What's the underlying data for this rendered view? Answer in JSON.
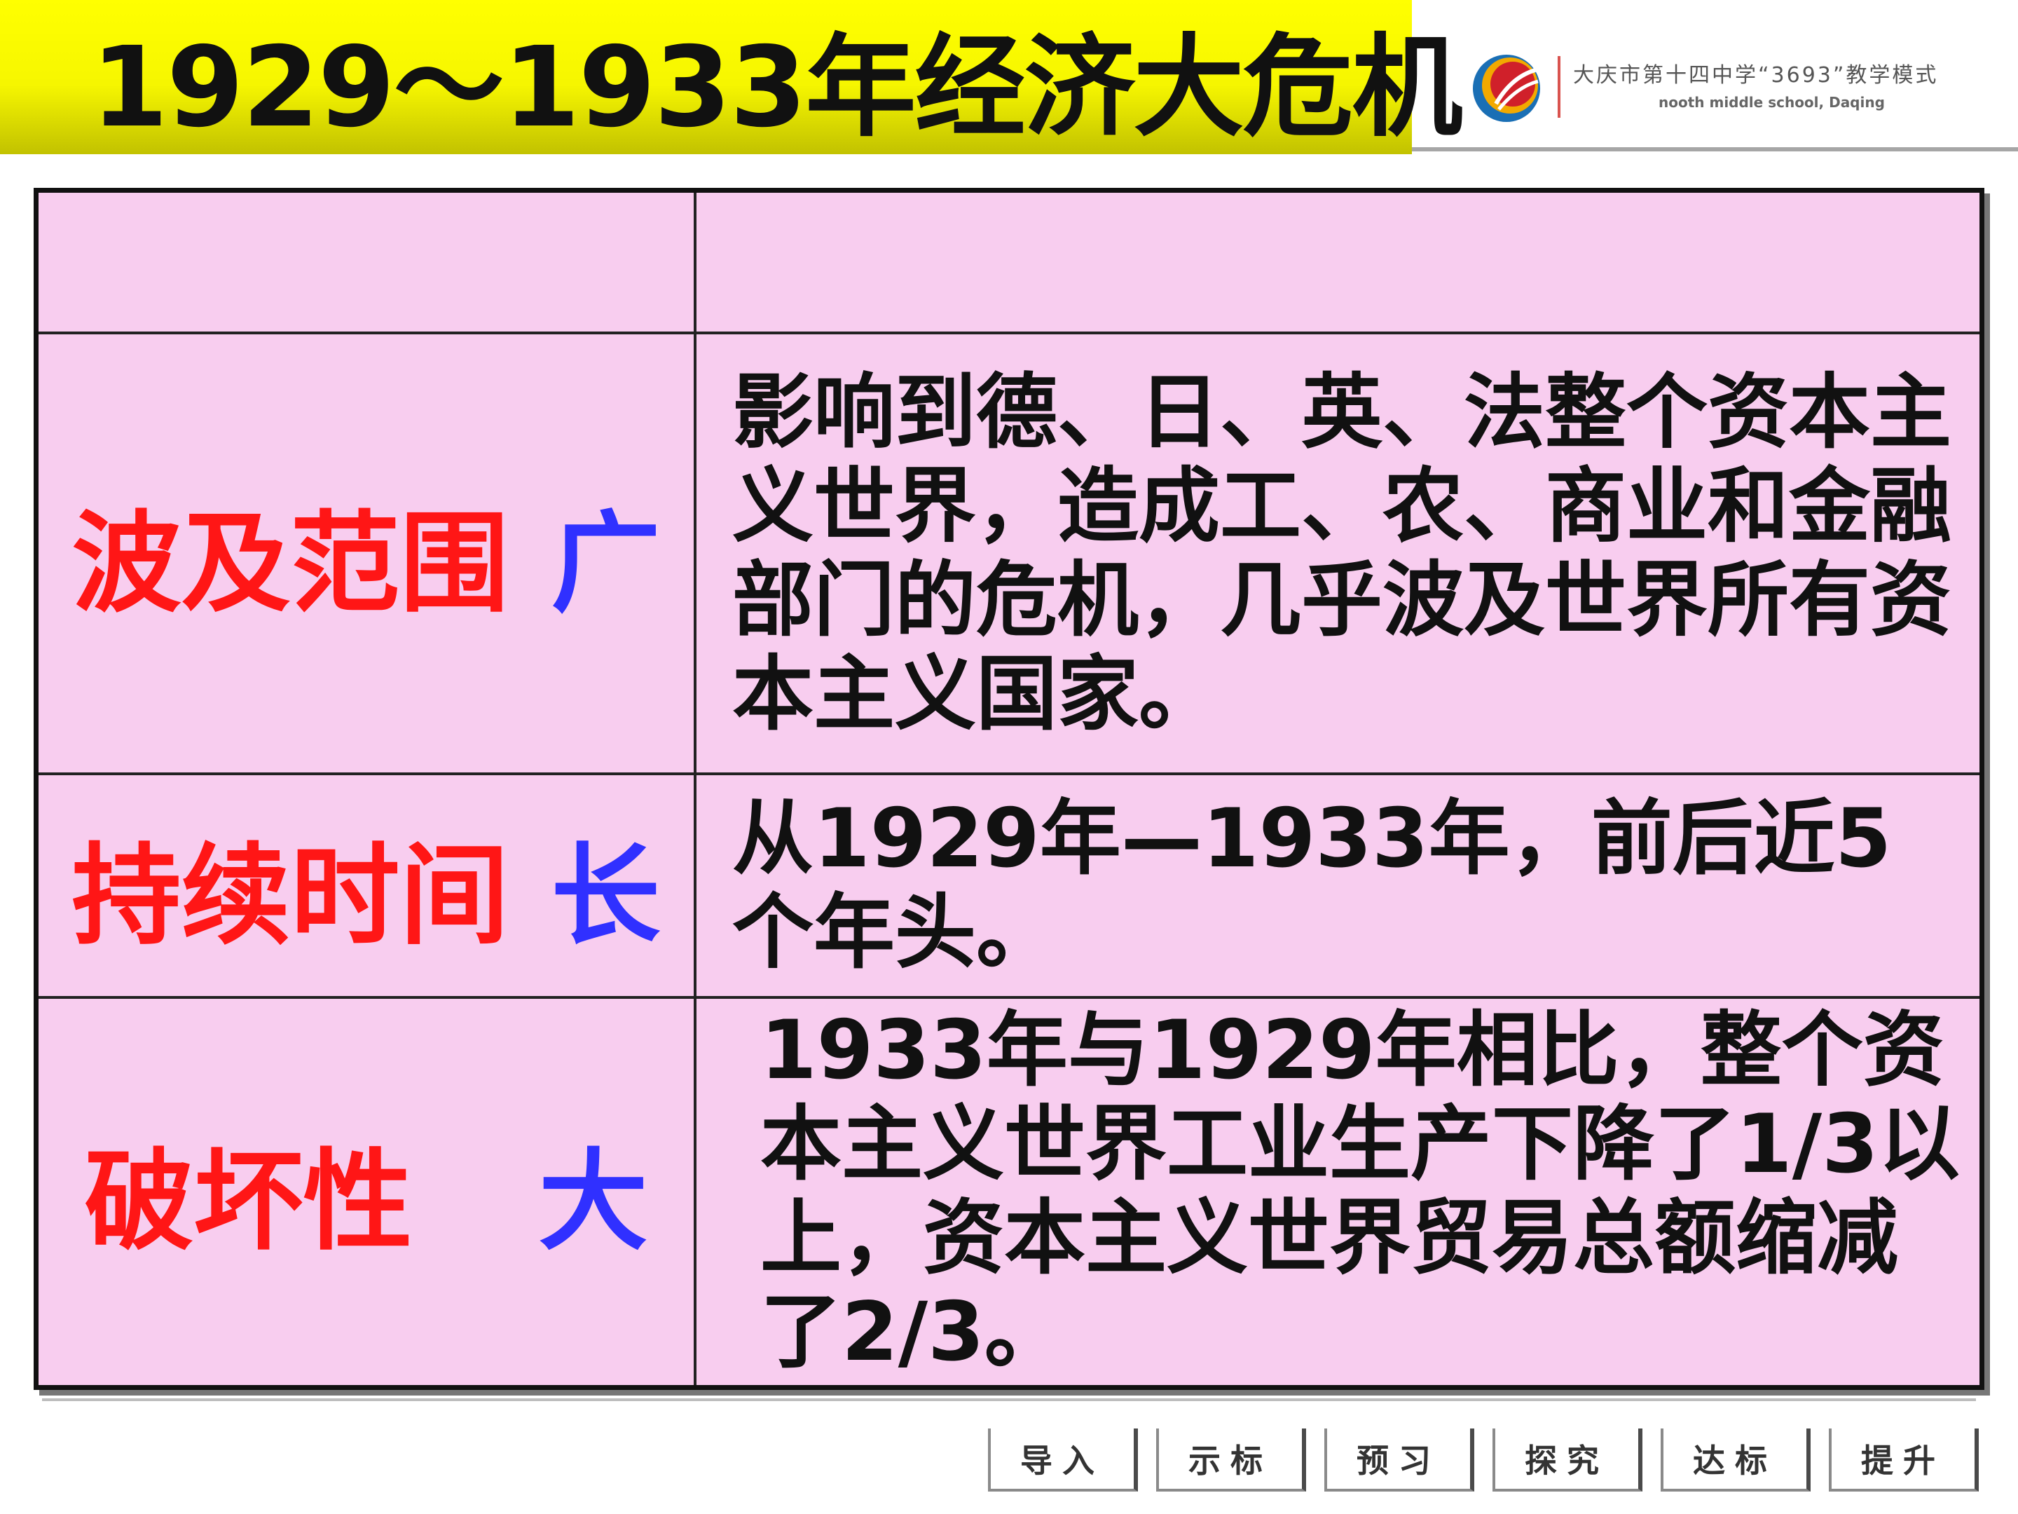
{
  "header": {
    "title": "1929～1933年经济大危机",
    "logo": {
      "school_name": "大庆市第十四中学“3693”教学模式",
      "school_en": "nooth middle school, Daqing",
      "mark_colors": [
        "#d0202a",
        "#f2a900",
        "#1a6fb5"
      ]
    }
  },
  "table": {
    "header_row": {
      "left": "",
      "right": ""
    },
    "rows": [
      {
        "label": "波及范围",
        "emphasis": "广",
        "content": "影响到德、日、英、法整个资本主义世界，造成工、农、商业和金融部门的危机，几乎波及世界所有资本主义国家。"
      },
      {
        "label": "持续时间",
        "emphasis": "长",
        "content": "从1929年—1933年，前后近5个年头。"
      },
      {
        "label": "破坏性",
        "emphasis": "大",
        "content": "1933年与1929年相比，整个资本主义世界工业生产下降了1/3以上，资本主义世界贸易总额缩减了2/3。"
      }
    ],
    "colors": {
      "cell_bg": "#f8cdef",
      "label": "#ff1616",
      "emphasis": "#3030ff"
    }
  },
  "nav": {
    "buttons": [
      "导入",
      "示标",
      "预习",
      "探究",
      "达标",
      "提升"
    ]
  }
}
